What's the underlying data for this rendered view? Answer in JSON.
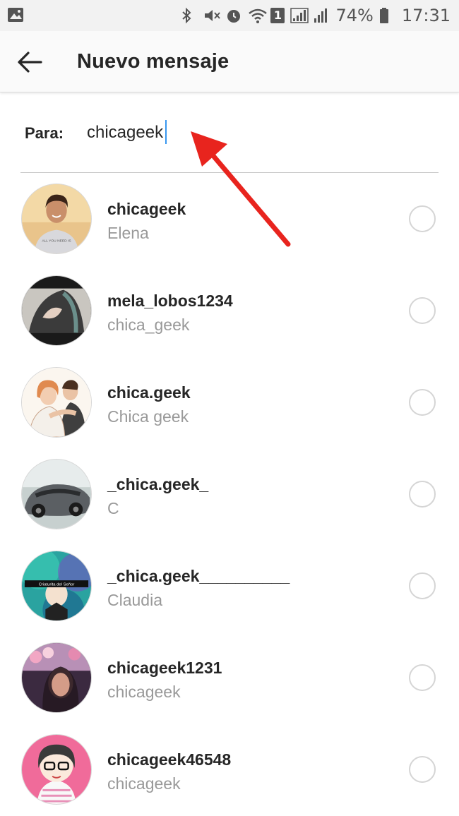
{
  "status_bar": {
    "battery": "74%",
    "time": "17:31",
    "notification_count": "1",
    "icons": [
      "image-icon",
      "bluetooth-icon",
      "mute-icon",
      "alarm-icon",
      "wifi-icon",
      "signal-icon",
      "battery-icon"
    ]
  },
  "header": {
    "title": "Nuevo mensaje",
    "back_icon": "arrow-left-icon"
  },
  "recipient": {
    "label": "Para:",
    "value": "chicageek"
  },
  "annotation": {
    "color": "#e8241e",
    "icon": "red-arrow"
  },
  "results": [
    {
      "username": "chicageek",
      "name": "Elena"
    },
    {
      "username": "mela_lobos1234",
      "name": "chica_geek"
    },
    {
      "username": "chica.geek",
      "name": "Chica geek"
    },
    {
      "username": "_chica.geek_",
      "name": "C"
    },
    {
      "username": "_chica.geek__________",
      "name": "Claudia"
    },
    {
      "username": "chicageek1231",
      "name": "chicageek"
    },
    {
      "username": "chicageek46548",
      "name": "chicageek"
    }
  ],
  "avatar_text": {
    "badge_4": "Criaturita del Señor"
  },
  "colors": {
    "accent": "#3897f0",
    "secondary_text": "#999999",
    "divider": "#c7c7c7"
  }
}
